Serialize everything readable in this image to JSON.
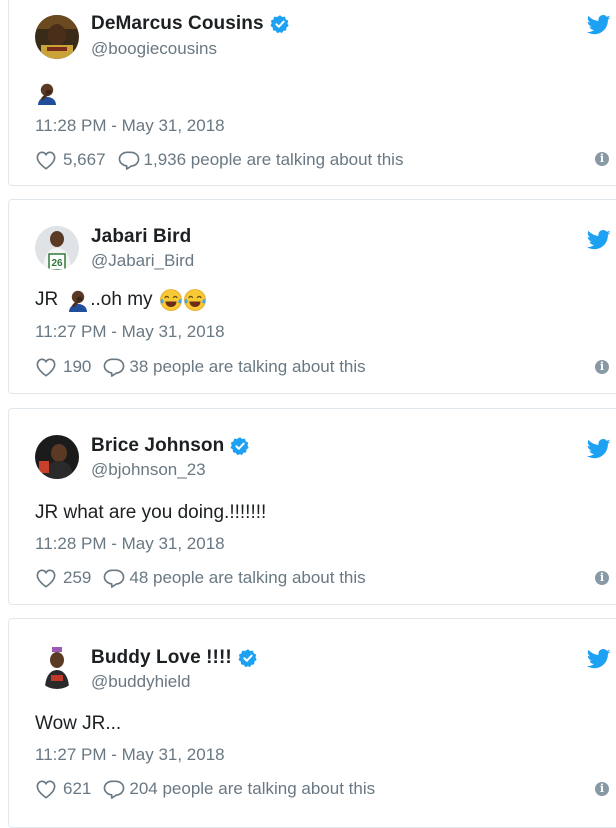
{
  "brand_colors": {
    "twitter_blue": "#1da1f2",
    "muted_text": "#697882",
    "border": "#e1e8ed"
  },
  "tweets": [
    {
      "name": "DeMarcus Cousins",
      "handle": "@boogiecousins",
      "verified": true,
      "avatar": "avatar-demarcus",
      "text": "",
      "emojis": [
        "facepalm-emoji"
      ],
      "time": "11:28 PM - May 31, 2018",
      "likes": "5,667",
      "talking": "1,936 people are talking about this"
    },
    {
      "name": "Jabari Bird",
      "handle": "@Jabari_Bird",
      "verified": false,
      "avatar": "avatar-jabari",
      "text_prefix": "JR",
      "text_suffix": "..oh my",
      "emojis": [
        "facepalm-emoji",
        "tears-of-joy-emoji",
        "tears-of-joy-emoji"
      ],
      "time": "11:27 PM - May 31, 2018",
      "likes": "190",
      "talking": "38 people are talking about this"
    },
    {
      "name": "Brice Johnson",
      "handle": "@bjohnson_23",
      "verified": true,
      "avatar": "avatar-brice",
      "text": "JR what are you doing.!!!!!!!",
      "time": "11:28 PM - May 31, 2018",
      "likes": "259",
      "talking": "48 people are talking about this"
    },
    {
      "name": "Buddy Love !!!!",
      "handle": "@buddyhield",
      "verified": true,
      "avatar": "avatar-buddy",
      "text": "Wow JR...",
      "time": "11:27 PM - May 31, 2018",
      "likes": "621",
      "talking": "204 people are talking about this"
    }
  ]
}
